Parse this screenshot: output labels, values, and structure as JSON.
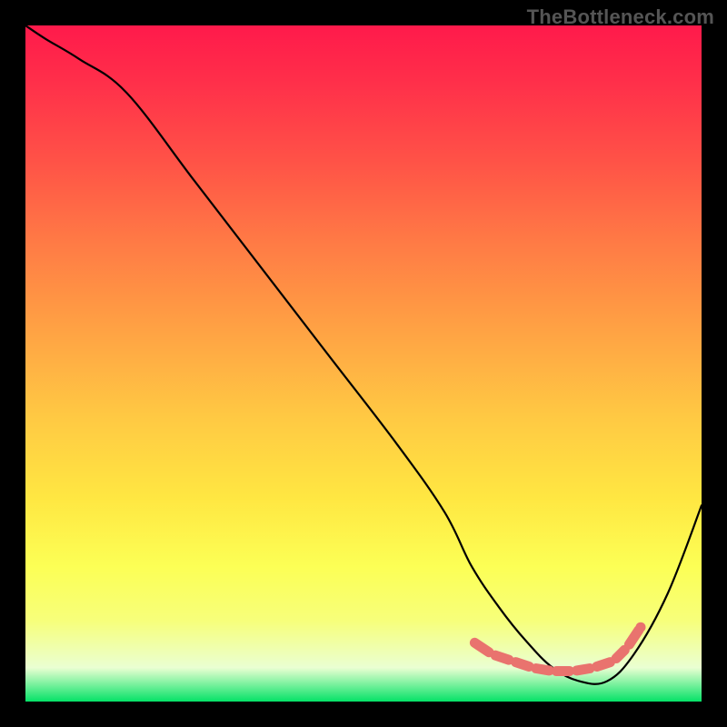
{
  "watermark": "TheBottleneck.com",
  "chart_data": {
    "type": "line",
    "title": "",
    "xlabel": "",
    "ylabel": "",
    "xlim": [
      0,
      100
    ],
    "ylim": [
      0,
      100
    ],
    "series": [
      {
        "name": "bottleneck-curve",
        "x": [
          0,
          3,
          8,
          15,
          25,
          35,
          45,
          55,
          62,
          66,
          70,
          74,
          78,
          82,
          86,
          90,
          95,
          100
        ],
        "y": [
          100,
          98,
          95,
          90,
          77,
          64,
          51,
          38,
          28,
          20,
          14,
          9,
          5,
          3,
          3,
          7,
          16,
          29
        ]
      }
    ],
    "markers": {
      "name": "bottleneck-range",
      "x": [
        66,
        69,
        72,
        75,
        78,
        81,
        84,
        87,
        89,
        91
      ],
      "y": [
        9,
        7,
        6,
        5,
        4.5,
        4.5,
        5,
        6,
        8,
        11
      ]
    }
  }
}
